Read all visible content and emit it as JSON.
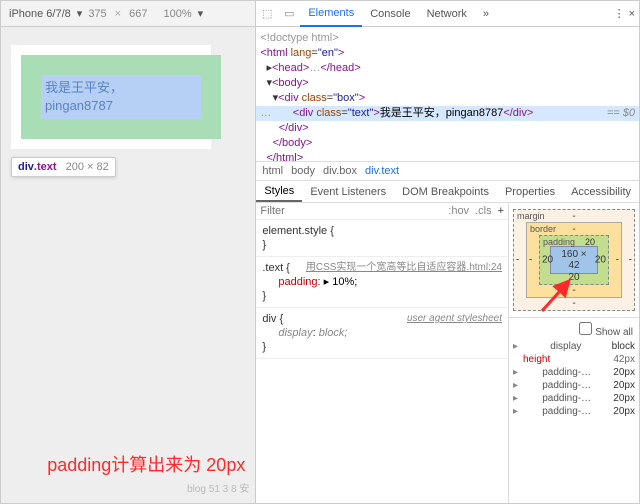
{
  "device": {
    "name": "iPhone 6/7/8",
    "width": "375",
    "height": "667",
    "zoom": "100%"
  },
  "preview": {
    "text_line1": "我是王平安，",
    "text_line2": "pingan8787",
    "tooltip_tag": "div",
    "tooltip_class": ".text",
    "tooltip_dims": "200 × 82"
  },
  "annotation": "padding计算出来为 20px",
  "watermark": "blog 51 3 8 安",
  "devtools": {
    "tabs": [
      "Elements",
      "Console",
      "Network"
    ],
    "active_tab": "Elements",
    "tree": {
      "doctype": "<!doctype html>",
      "html_open": "<html lang=\"en\">",
      "head": "<head>…</head>",
      "body_open": "<body>",
      "box_open": "<div class=\"box\">",
      "text_open_tag": "div",
      "text_open_class": "text",
      "text_content": "我是王平安，pingan8787",
      "text_close": "</div>",
      "badge": "== $0",
      "box_close": "</div>",
      "body_close": "</body>",
      "html_close": "</html>"
    },
    "breadcrumb": [
      "html",
      "body",
      "div.box",
      "div.text"
    ],
    "sub_tabs": [
      "Styles",
      "Event Listeners",
      "DOM Breakpoints",
      "Properties",
      "Accessibility"
    ],
    "filter_placeholder": "Filter",
    "hov": ":hov",
    "cls": ".cls",
    "rules": {
      "element_style": "element.style {",
      "close": "}",
      "src": "用CSS实现一个宽高等比自适应容器.html:24",
      "text_sel": ".text {",
      "pad_prop": "padding",
      "pad_val": "▸ 10%;",
      "ua_label": "user agent stylesheet",
      "div_sel": "div {",
      "disp_prop": "display",
      "disp_val": "block;"
    },
    "boxmodel": {
      "margin_label": "margin",
      "border_label": "border",
      "padding_label": "padding",
      "pad_value": "20",
      "content": "160 × 42",
      "dash": "-"
    },
    "computed": {
      "show_all": "Show all",
      "rows": [
        {
          "k": "display",
          "v": "block"
        },
        {
          "k": "height",
          "v": "42px"
        },
        {
          "k": "padding-…",
          "v": "20px"
        },
        {
          "k": "padding-…",
          "v": "20px"
        },
        {
          "k": "padding-…",
          "v": "20px"
        },
        {
          "k": "padding-…",
          "v": "20px"
        }
      ]
    }
  }
}
